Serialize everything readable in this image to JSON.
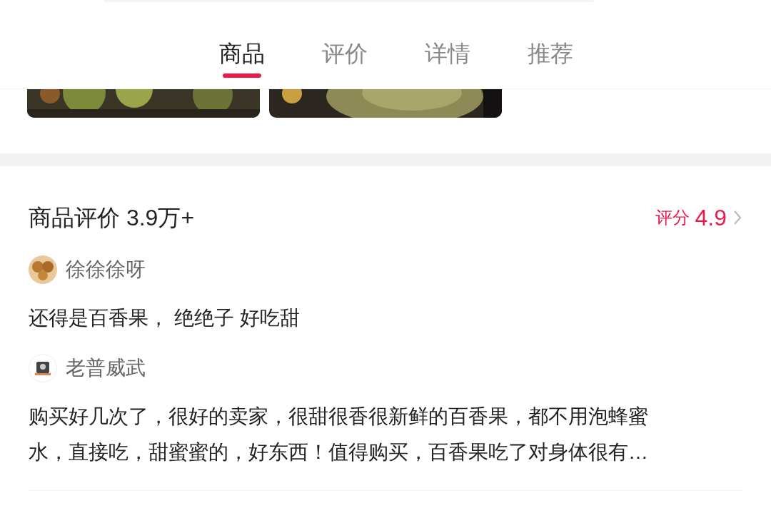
{
  "tabs": [
    {
      "label": "商品",
      "selected": true
    },
    {
      "label": "评价",
      "selected": false
    },
    {
      "label": "详情",
      "selected": false
    },
    {
      "label": "推荐",
      "selected": false
    }
  ],
  "reviews_section": {
    "title": "商品评价 3.9万+",
    "score_label": "评分",
    "score": "4.9",
    "reviews": [
      {
        "user": "徐徐徐呀",
        "lines": [
          "还得是百香果， 绝绝子 好吃甜"
        ]
      },
      {
        "user": "老普威武",
        "lines": [
          "购买好几次了，很好的卖家，很甜很香很新鲜的百香果，都不用泡蜂蜜",
          "水，直接吃，甜蜜蜜的，好东西！值得购买，百香果吃了对身体很有…"
        ]
      }
    ]
  }
}
